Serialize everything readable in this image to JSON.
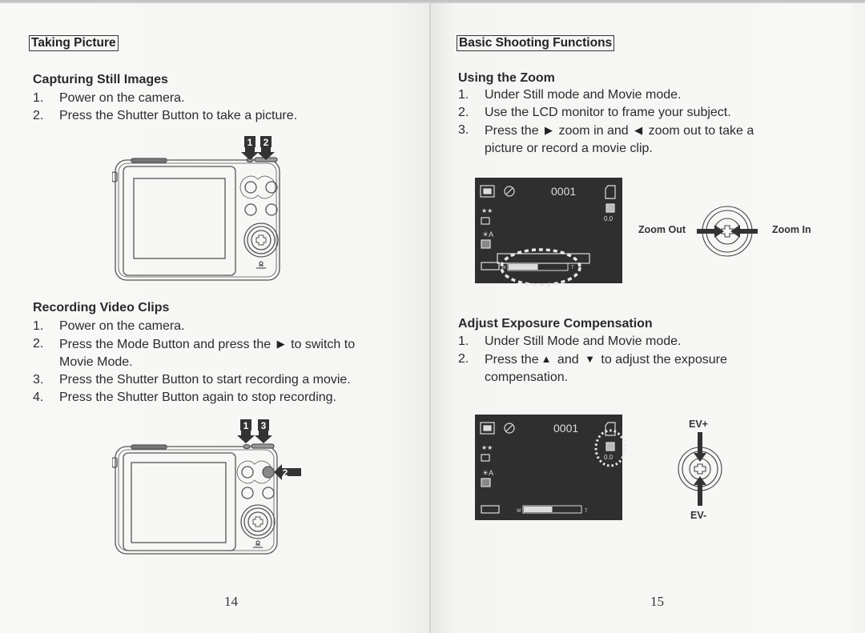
{
  "left_page": {
    "section_title": "Taking Picture",
    "capturing": {
      "heading": "Capturing Still Images",
      "steps": [
        {
          "num": "1.",
          "text": "Power on the camera."
        },
        {
          "num": "2.",
          "text": "Press the Shutter Button to take a picture."
        }
      ],
      "figure_callouts": [
        "1",
        "2"
      ]
    },
    "recording": {
      "heading": "Recording Video Clips",
      "steps": [
        {
          "num": "1.",
          "text": "Power on the camera."
        },
        {
          "num": "2.",
          "text_before": "Press the Mode Button and press the",
          "icon": "right-arrow-icon",
          "text_after": "to switch to",
          "text_cont": "Movie Mode."
        },
        {
          "num": "3.",
          "text": "Press the Shutter Button to start recording a movie."
        },
        {
          "num": "4.",
          "text": "Press the Shutter Button again to stop recording."
        }
      ],
      "figure_callouts": [
        "1",
        "3",
        "2"
      ]
    },
    "page_number": "14"
  },
  "right_page": {
    "section_title": "Basic Shooting Functions",
    "zoom": {
      "heading": "Using the Zoom",
      "steps": [
        {
          "num": "1.",
          "text": "Under Still mode and Movie mode."
        },
        {
          "num": "2.",
          "text": "Use the LCD monitor to frame your subject."
        },
        {
          "num": "3.",
          "text_before": "Press the",
          "text_mid": "zoom in and",
          "text_after": "zoom out to take a",
          "text_cont": "picture or record a movie clip."
        }
      ],
      "lcd": {
        "counter": "0001",
        "ev_value": "0.0",
        "zoom_w": "W",
        "zoom_t": "T",
        "zoom_level_fraction": 0.5
      },
      "zoom_out_label": "Zoom Out",
      "zoom_in_label": "Zoom In"
    },
    "exposure": {
      "heading": "Adjust Exposure Compensation",
      "steps": [
        {
          "num": "1.",
          "text": "Under Still Mode and Movie mode."
        },
        {
          "num": "2.",
          "text_before": "Press the",
          "text_mid": "and",
          "text_after": "to adjust the exposure",
          "text_cont": "compensation."
        }
      ],
      "lcd": {
        "counter": "0001",
        "ev_value": "0.0",
        "zoom_w": "W",
        "zoom_t": "T",
        "zoom_level_fraction": 0.5
      },
      "ev_plus_label": "EV+",
      "ev_minus_label": "EV-"
    },
    "page_number": "15"
  },
  "glyphs": {
    "right": "▶",
    "left": "◀",
    "up": "▲",
    "down": "▼"
  }
}
